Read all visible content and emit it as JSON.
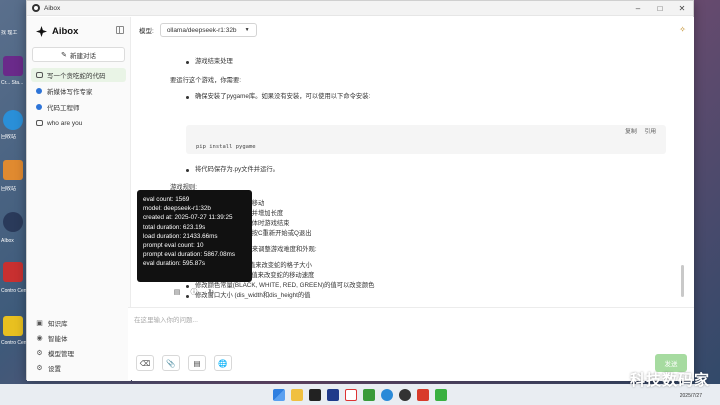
{
  "window": {
    "title": "Aibox"
  },
  "desktop": {
    "items": [
      {
        "label": "找 理工"
      },
      {
        "label": "Cr... Sta..."
      },
      {
        "label": "回收站"
      },
      {
        "label": "回收站"
      },
      {
        "label": "AIbox"
      },
      {
        "label": "Contro Center"
      },
      {
        "label": "Contro Center"
      }
    ]
  },
  "sidebar": {
    "brand": "Aibox",
    "new_chat": "新建对话",
    "conversations": [
      {
        "label": "写一个贪吃蛇的代码",
        "icon": "chat-icon",
        "active": true
      },
      {
        "label": "新媒体写作专家",
        "icon": "agent-icon",
        "active": false
      },
      {
        "label": "代码工程师",
        "icon": "agent-icon",
        "active": false
      },
      {
        "label": "who are you",
        "icon": "chat-icon",
        "active": false
      }
    ],
    "bottom_links": [
      {
        "label": "知识库",
        "icon": "book-icon"
      },
      {
        "label": "智能体",
        "icon": "bot-icon"
      },
      {
        "label": "模型管理",
        "icon": "model-icon"
      },
      {
        "label": "设置",
        "icon": "gear-icon"
      }
    ]
  },
  "header": {
    "model_label": "模型:",
    "model_value": "ollama/deepseek-r1:32b"
  },
  "message": {
    "bullet_end": "游戏结束处理",
    "run_intro": "要运行这个游戏，你需要:",
    "step1": "确保安装了pygame库。如果没有安装，可以使用以下命令安装:",
    "code": {
      "copy": "复制",
      "quote": "引用",
      "text": "pip install pygame"
    },
    "step2": "将代码保存为.py文件并运行。",
    "rules_title": "游戏规则:",
    "rules": [
      "使用方向键控制蛇的移动",
      "吃到食物后蛇会变长并增加长度",
      "撞到墙壁或自己的身体时游戏结束",
      "游戏结束后可以选择按C重新开始或Q退出"
    ],
    "tweak_intro": "你可以根据需要调整以下参数来调整游戏难度和外观:",
    "tweaks": [
      "调整snake_block的值来改变蛇的格子大小",
      "调整snake_speed的值来改变蛇的移动速度",
      "修改颜色常量(BLACK, WHITE, RED, GREEN)的值可以改变颜色",
      "修改窗口大小 (dis_width和dis_height的值"
    ]
  },
  "tooltip": {
    "lines": [
      "eval count: 1569",
      "model: deepseek-r1:32b",
      "created at: 2025-07-27 11:39:25",
      "total duration: 623.19s",
      "load duration: 21433.66ms",
      "prompt eval count: 10",
      "prompt eval duration: 5867.08ms",
      "eval duration: 595.87s"
    ]
  },
  "input": {
    "placeholder": "在这里输入你的问题...",
    "send": "发送"
  },
  "watermark": "科技数码家",
  "taskbar": {
    "date": "2025/7/27"
  },
  "colors": {
    "accent_green": "#a6dba0",
    "active_bg": "#e9f4e6",
    "agent_blue": "#2d74d8"
  }
}
